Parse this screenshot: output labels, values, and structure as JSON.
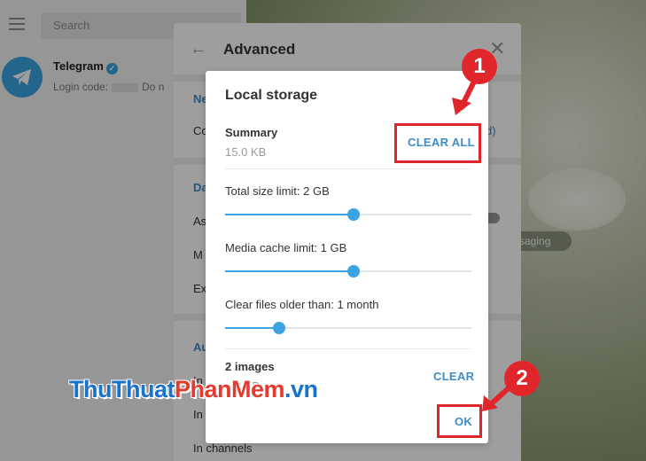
{
  "sidebar": {
    "menu_icon": "hamburger-icon",
    "search_placeholder": "Search",
    "chat": {
      "name": "Telegram",
      "verified_icon": "verified-check-icon",
      "preview_prefix": "Login code:",
      "preview_suffix": "Do n"
    }
  },
  "background": {
    "pill_text": "ssaging"
  },
  "advanced": {
    "title": "Advanced",
    "back_icon": "arrow-left-icon",
    "close_icon": "close-icon",
    "rows": {
      "section1_header": "Ne",
      "row_co": "Co",
      "row_co_right": "d)",
      "section2_header": "Da",
      "row_as": "As",
      "row_m": "M",
      "row_ex": "Ex",
      "section3_header": "Au",
      "row_in1": "In",
      "row_in2": "In",
      "row_in_channels": "In channels"
    }
  },
  "dialog": {
    "title": "Local storage",
    "summary_label": "Summary",
    "summary_size": "15.0 KB",
    "clear_all_label": "CLEAR ALL",
    "total_size_label": "Total size limit: 2 GB",
    "total_size_level": 0.52,
    "media_cache_label": "Media cache limit: 1 GB",
    "media_cache_level": 0.52,
    "clear_older_label": "Clear files older than: 1 month",
    "clear_older_level": 0.22,
    "images_label": "2 images",
    "images_size": "...0 KB",
    "clear_label": "CLEAR",
    "ok_label": "OK"
  },
  "annotations": {
    "badge1": "1",
    "badge2": "2",
    "accent_color": "#e0262a"
  },
  "watermark": {
    "part1": "ThuThuat",
    "part2": "PhanMem",
    "part3": ".vn"
  }
}
